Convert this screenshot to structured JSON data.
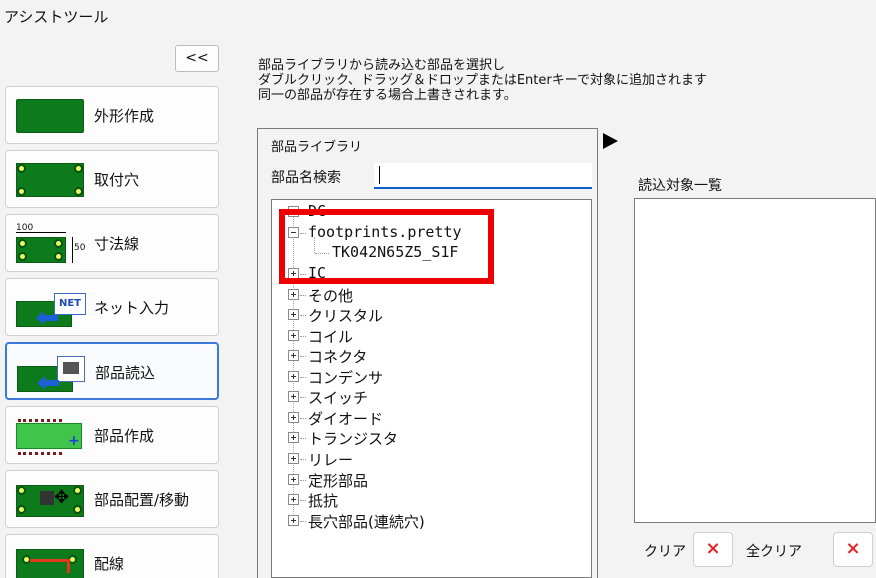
{
  "window": {
    "title": "アシストツール"
  },
  "sidebar": {
    "collapse_label": "<<",
    "items": [
      {
        "label": "外形作成"
      },
      {
        "label": "取付穴"
      },
      {
        "label": "寸法線",
        "dim_top": "100",
        "dim_side": "50"
      },
      {
        "label": "ネット入力",
        "badge": "NET"
      },
      {
        "label": "部品読込",
        "active": true
      },
      {
        "label": "部品作成"
      },
      {
        "label": "部品配置/移動"
      },
      {
        "label": "配線"
      }
    ]
  },
  "instructions": [
    "部品ライブラリから読み込む部品を選択し",
    "ダブルクリック、ドラッグ＆ドロップまたはEnterキーで対象に追加されます",
    "同一の部品が存在する場合上書きされます。"
  ],
  "library": {
    "title": "部品ライブラリ",
    "search_label": "部品名検索",
    "search_value": "",
    "tree": [
      {
        "label": "DC",
        "expanded": false
      },
      {
        "label": "footprints.pretty",
        "expanded": true,
        "children": [
          "TK042N65Z5_S1F"
        ]
      },
      {
        "label": "IC",
        "expanded": false
      },
      {
        "label": "その他",
        "expanded": false
      },
      {
        "label": "クリスタル",
        "expanded": false
      },
      {
        "label": "コイル",
        "expanded": false
      },
      {
        "label": "コネクタ",
        "expanded": false
      },
      {
        "label": "コンデンサ",
        "expanded": false
      },
      {
        "label": "スイッチ",
        "expanded": false
      },
      {
        "label": "ダイオード",
        "expanded": false
      },
      {
        "label": "トランジスタ",
        "expanded": false
      },
      {
        "label": "リレー",
        "expanded": false
      },
      {
        "label": "定形部品",
        "expanded": false
      },
      {
        "label": "抵抗",
        "expanded": false
      },
      {
        "label": "長穴部品(連続穴)",
        "expanded": false
      }
    ]
  },
  "targets": {
    "title": "読込対象一覧",
    "items": [],
    "clear_label": "クリア",
    "clear_all_label": "全クリア",
    "clear_icon": "×"
  },
  "colors": {
    "accent": "#0a61c9",
    "highlight": "#ee0000",
    "pcb": "#0d7a1b",
    "delete": "#e4262a"
  }
}
